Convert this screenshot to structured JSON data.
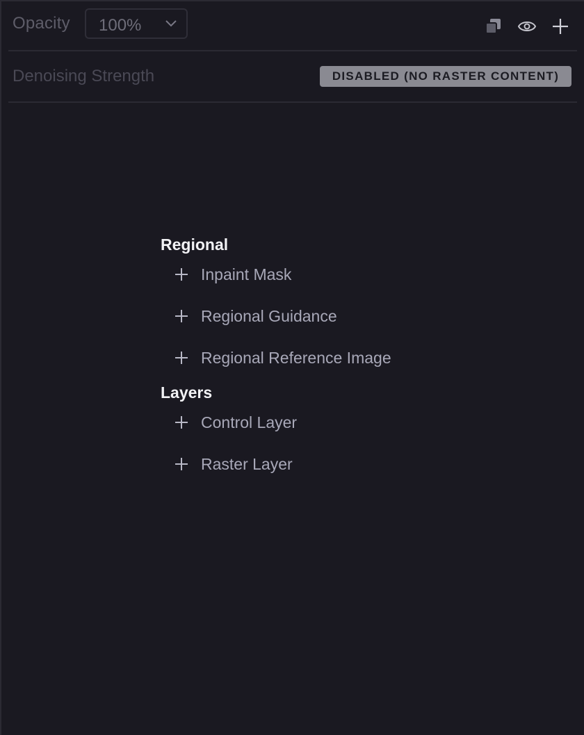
{
  "toolbar": {
    "opacity_label": "Opacity",
    "opacity_value": "100%",
    "icons": [
      "duplicate-layers-icon",
      "eye-icon",
      "plus-icon"
    ]
  },
  "denoise": {
    "label": "Denoising Strength",
    "badge": "DISABLED (NO RASTER CONTENT)"
  },
  "menu": {
    "groups": [
      {
        "title": "Regional",
        "items": [
          {
            "label": "Inpaint Mask"
          },
          {
            "label": "Regional Guidance"
          },
          {
            "label": "Regional Reference Image"
          }
        ]
      },
      {
        "title": "Layers",
        "items": [
          {
            "label": "Control Layer"
          },
          {
            "label": "Raster Layer"
          }
        ]
      }
    ]
  },
  "colors": {
    "background": "#1a1921",
    "divider": "#2b2a33",
    "badge_bg": "#8a8a92",
    "heading": "#f2f2f5",
    "item_text": "#a8a8b8"
  }
}
